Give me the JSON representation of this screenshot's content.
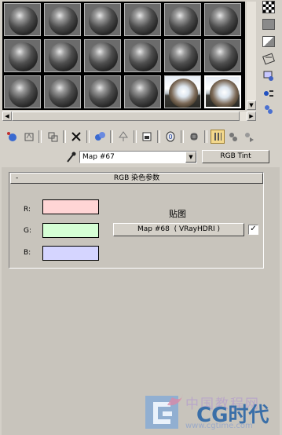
{
  "sample_slots": {
    "rows": 3,
    "columns": 6,
    "hdri_slots": [
      16,
      17
    ],
    "selected_slot": 17
  },
  "toolbar": {
    "buttons": [
      "get-material-icon",
      "put-to-scene-icon",
      "assign-to-selection-icon",
      "delete-icon",
      "make-unique-icon",
      "go-to-parent-icon",
      "put-to-library-icon",
      "material-id-channel-icon",
      "show-map-icon",
      "show-end-result-icon",
      "go-forward-sibling-icon",
      "options-icon"
    ],
    "active_color": "#f3d88c"
  },
  "map_row": {
    "name": "Map #67",
    "type_button": "RGB Tint"
  },
  "rollout": {
    "title": "RGB 染色参数",
    "collapse_symbol": "-",
    "channels": [
      {
        "label": "R:",
        "color": "#ffd5d5"
      },
      {
        "label": "G:",
        "color": "#d5ffd5"
      },
      {
        "label": "B:",
        "color": "#d5d5ff"
      }
    ],
    "map_heading": "贴图",
    "map_button": "Map #68  ( VRayHDRI )",
    "map_enabled_mark": "✓"
  },
  "watermark": {
    "text_cn": "中国教程网",
    "brand": "CG时代",
    "url": "www.cgtime.com"
  }
}
